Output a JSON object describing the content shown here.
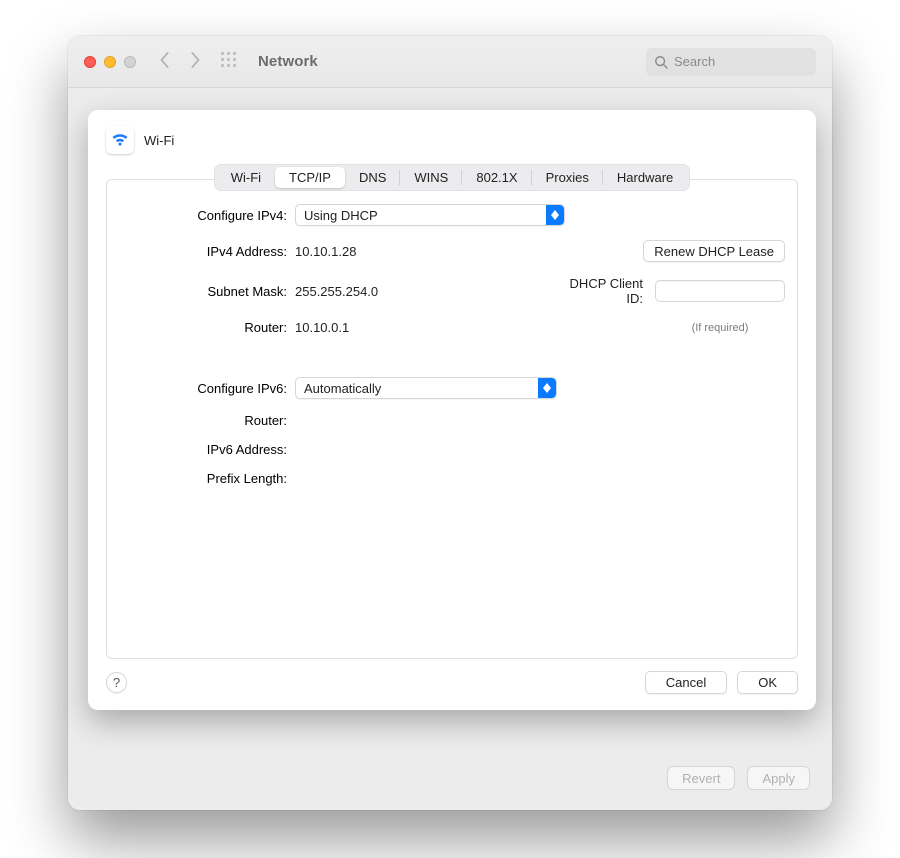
{
  "toolbar": {
    "title": "Network",
    "search_placeholder": "Search"
  },
  "sheet": {
    "connection_name": "Wi-Fi",
    "tabs": [
      "Wi-Fi",
      "TCP/IP",
      "DNS",
      "WINS",
      "802.1X",
      "Proxies",
      "Hardware"
    ],
    "active_tab": "TCP/IP"
  },
  "ipv4": {
    "configure_label": "Configure IPv4:",
    "configure_value": "Using DHCP",
    "address_label": "IPv4 Address:",
    "address_value": "10.10.1.28",
    "subnet_label": "Subnet Mask:",
    "subnet_value": "255.255.254.0",
    "router_label": "Router:",
    "router_value": "10.10.0.1",
    "renew_button": "Renew DHCP Lease",
    "dhcp_client_label": "DHCP Client ID:",
    "dhcp_client_value": "",
    "dhcp_hint": "(If required)"
  },
  "ipv6": {
    "configure_label": "Configure IPv6:",
    "configure_value": "Automatically",
    "router_label": "Router:",
    "router_value": "",
    "address_label": "IPv6 Address:",
    "address_value": "",
    "prefix_label": "Prefix Length:",
    "prefix_value": ""
  },
  "footer": {
    "help": "?",
    "cancel": "Cancel",
    "ok": "OK"
  },
  "backdrop_footer": {
    "revert": "Revert",
    "apply": "Apply"
  }
}
